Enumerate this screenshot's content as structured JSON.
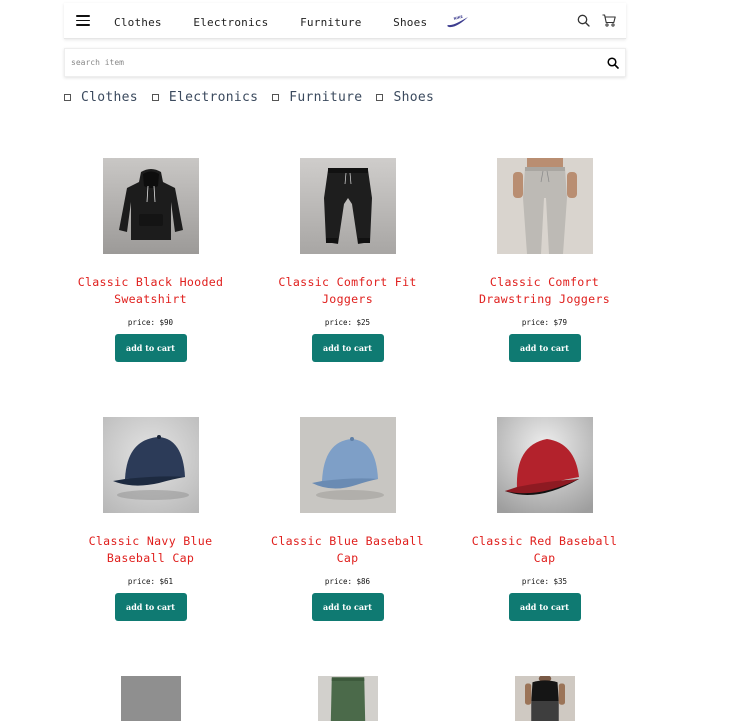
{
  "nav": {
    "menu_icon": "hamburger-menu-icon",
    "links": [
      "Clothes",
      "Electronics",
      "Furniture",
      "Shoes"
    ],
    "logo": "nike-logo",
    "search_icon": "search-icon",
    "cart_icon": "cart-icon"
  },
  "search": {
    "placeholder": "search item",
    "value": ""
  },
  "filters": [
    "Clothes",
    "Electronics",
    "Furniture",
    "Shoes"
  ],
  "products": [
    {
      "name": "Classic Black Hooded Sweatshirt",
      "price_label": "price: $90",
      "button": "add to cart",
      "image": "black-hoodie"
    },
    {
      "name": "Classic Comfort Fit Joggers",
      "price_label": "price: $25",
      "button": "add to cart",
      "image": "black-joggers"
    },
    {
      "name": "Classic Comfort Drawstring Joggers",
      "price_label": "price: $79",
      "button": "add to cart",
      "image": "grey-drawstring-joggers"
    },
    {
      "name": "Classic Navy Blue Baseball Cap",
      "price_label": "price: $61",
      "button": "add to cart",
      "image": "navy-cap"
    },
    {
      "name": "Classic Blue Baseball Cap",
      "price_label": "price: $86",
      "button": "add to cart",
      "image": "light-blue-cap"
    },
    {
      "name": "Classic Red Baseball Cap",
      "price_label": "price: $35",
      "button": "add to cart",
      "image": "red-cap"
    }
  ],
  "colors": {
    "accent_button": "#0f7a72",
    "product_title": "#e0201e",
    "filter_label": "#3b4a5e"
  }
}
